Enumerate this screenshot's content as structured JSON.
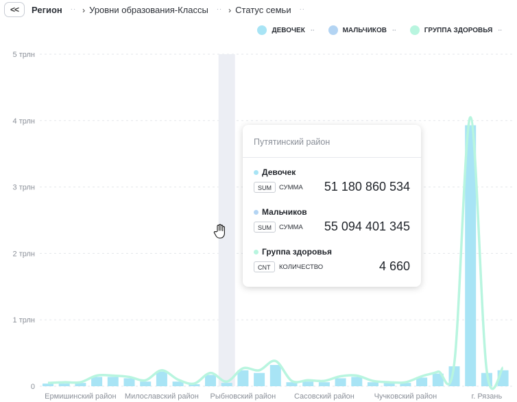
{
  "breadcrumb": {
    "back_label": "<<",
    "items": [
      {
        "label": "Регион"
      },
      {
        "label": "Уровни образования-Классы"
      },
      {
        "label": "Статус семьи"
      }
    ]
  },
  "legend": [
    {
      "label": "ДЕВОЧЕК",
      "color": "#a8e4f5"
    },
    {
      "label": "МАЛЬЧИКОВ",
      "color": "#b3d4f3"
    },
    {
      "label": "ГРУППА ЗДОРОВЬЯ",
      "color": "#b8f5df"
    }
  ],
  "chart_data": {
    "type": "bar",
    "y_ticks": [
      "0",
      "1 трлн",
      "2 трлн",
      "3 трлн",
      "4 трлн",
      "5 трлн"
    ],
    "ylim": [
      0,
      5
    ],
    "y_unit": "трлн",
    "grid": true,
    "highlighted_index": 11,
    "x_tick_labels": [
      {
        "label": "Ермишинский район",
        "index": 2
      },
      {
        "label": "Милославский район",
        "index": 7
      },
      {
        "label": "Рыбновский район",
        "index": 12
      },
      {
        "label": "Сасовский район",
        "index": 17
      },
      {
        "label": "Чучковский район",
        "index": 22
      },
      {
        "label": "г. Рязань",
        "index": 27
      }
    ],
    "series": [
      {
        "name": "Девочек",
        "type": "bar",
        "color": "#a8e4f5",
        "values": [
          0.04,
          0.04,
          0.05,
          0.14,
          0.14,
          0.12,
          0.07,
          0.22,
          0.07,
          0.03,
          0.17,
          0.05,
          0.24,
          0.2,
          0.32,
          0.06,
          0.07,
          0.06,
          0.12,
          0.14,
          0.06,
          0.05,
          0.05,
          0.13,
          0.19,
          0.3,
          3.93,
          0.2,
          0.24
        ]
      },
      {
        "name": "Группа здоровья",
        "type": "line",
        "color": "#b8f5df",
        "values": [
          0.05,
          0.06,
          0.06,
          0.16,
          0.16,
          0.14,
          0.09,
          0.24,
          0.1,
          0.04,
          0.2,
          0.07,
          0.27,
          0.24,
          0.38,
          0.08,
          0.09,
          0.08,
          0.15,
          0.16,
          0.08,
          0.06,
          0.06,
          0.15,
          0.22,
          0.34,
          4.05,
          0.23,
          0.28
        ]
      }
    ]
  },
  "tooltip": {
    "title": "Путятинский район",
    "entries": [
      {
        "name": "Девочек",
        "color": "#a8e4f5",
        "badge": "SUM",
        "agg": "СУММА",
        "value": "51 180 860 534"
      },
      {
        "name": "Мальчиков",
        "color": "#b3d4f3",
        "badge": "SUM",
        "agg": "СУММА",
        "value": "55 094 401 345"
      },
      {
        "name": "Группа здоровья",
        "color": "#b8f5df",
        "badge": "CNT",
        "agg": "КОЛИЧЕСТВО",
        "value": "4 660"
      }
    ]
  }
}
